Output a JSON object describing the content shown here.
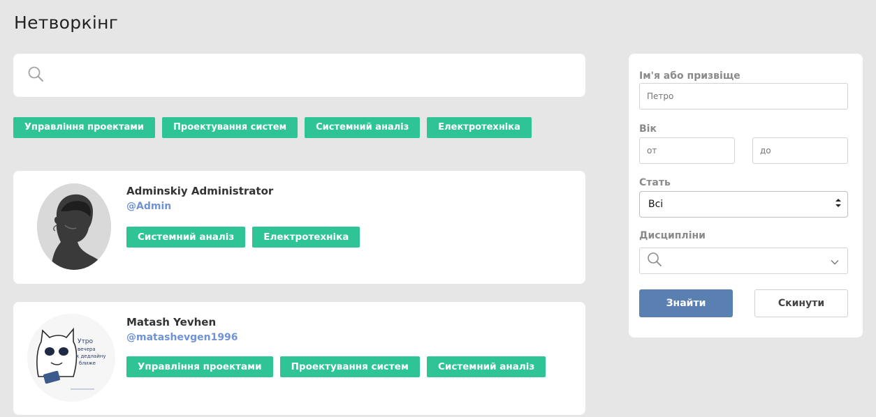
{
  "page": {
    "title": "Нетворкінг"
  },
  "search": {
    "placeholder": ""
  },
  "topic_tags": [
    "Управління проектами",
    "Проектування систем",
    "Системний аналіз",
    "Електротехніка"
  ],
  "people": [
    {
      "name": "Adminskiy Administrator",
      "handle": "@Admin",
      "tags": [
        "Системний аналіз",
        "Електротехніка"
      ]
    },
    {
      "name": "Matash Yevhen",
      "handle": "@matashevgen1996",
      "tags": [
        "Управління проектами",
        "Проектування систем",
        "Системний аналіз"
      ],
      "avatar_text": [
        "Утро",
        "вечера",
        "к дедлайну",
        "ближе"
      ]
    }
  ],
  "filters": {
    "name_label": "Ім'я або призвіще",
    "name_placeholder": "Петро",
    "age_label": "Вік",
    "age_from_placeholder": "от",
    "age_to_placeholder": "до",
    "gender_label": "Стать",
    "gender_value": "Всі",
    "disciplines_label": "Дисципліни",
    "submit_label": "Знайти",
    "reset_label": "Скинути"
  },
  "colors": {
    "tag": "#2fc496",
    "handle": "#6f93d6",
    "primary_button": "#5a7fb1"
  },
  "icons": [
    "search-icon",
    "chevron-down-icon",
    "select-arrows-icon"
  ]
}
